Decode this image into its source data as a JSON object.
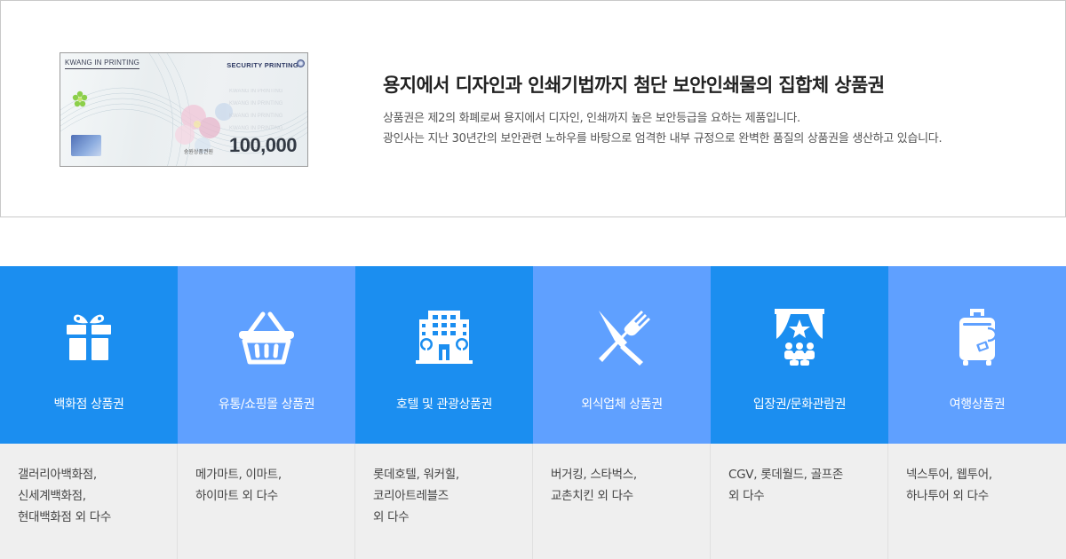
{
  "intro": {
    "voucher": {
      "brand": "KWANG IN PRINTING",
      "security": "SECURITY PRINTING",
      "amount": "100,000",
      "small_text": "숭원상품권원"
    },
    "title": "용지에서 디자인과 인쇄기법까지 첨단 보안인쇄물의 집합체 상품권",
    "desc_line1": "상품권은 제2의 화폐로써 용지에서 디자인, 인쇄까지 높은 보안등급을 요하는 제품입니다.",
    "desc_line2": "광인사는 지난 30년간의 보안관련 노하우를 바탕으로 엄격한 내부 규정으로 완벽한 품질의 상품권을 생산하고 있습니다."
  },
  "categories": [
    {
      "icon": "gift-icon",
      "label": "백화점 상품권",
      "lines": [
        "갤러리아백화점,",
        "신세계백화점,",
        "현대백화점 외 다수"
      ],
      "color": "#1b8ef0"
    },
    {
      "icon": "basket-icon",
      "label": "유통/쇼핑몰 상품권",
      "lines": [
        "메가마트, 이마트,",
        "하이마트 외 다수"
      ],
      "color": "#5fa0ff"
    },
    {
      "icon": "hotel-icon",
      "label": "호텔 및 관광상품권",
      "lines": [
        "롯데호텔, 워커힐,",
        "코리아트레블즈",
        "외 다수"
      ],
      "color": "#1b8ef0"
    },
    {
      "icon": "cutlery-icon",
      "label": "외식업체 상품권",
      "lines": [
        "버거킹, 스타벅스,",
        "교촌치킨 외 다수"
      ],
      "color": "#5fa0ff"
    },
    {
      "icon": "theater-icon",
      "label": "입장권/문화관람권",
      "lines": [
        "CGV, 롯데월드, 골프존",
        "외 다수"
      ],
      "color": "#1b8ef0"
    },
    {
      "icon": "luggage-icon",
      "label": "여행상품권",
      "lines": [
        "넥스투어, 웹투어,",
        "하나투어 외 다수"
      ],
      "color": "#5fa0ff"
    }
  ]
}
